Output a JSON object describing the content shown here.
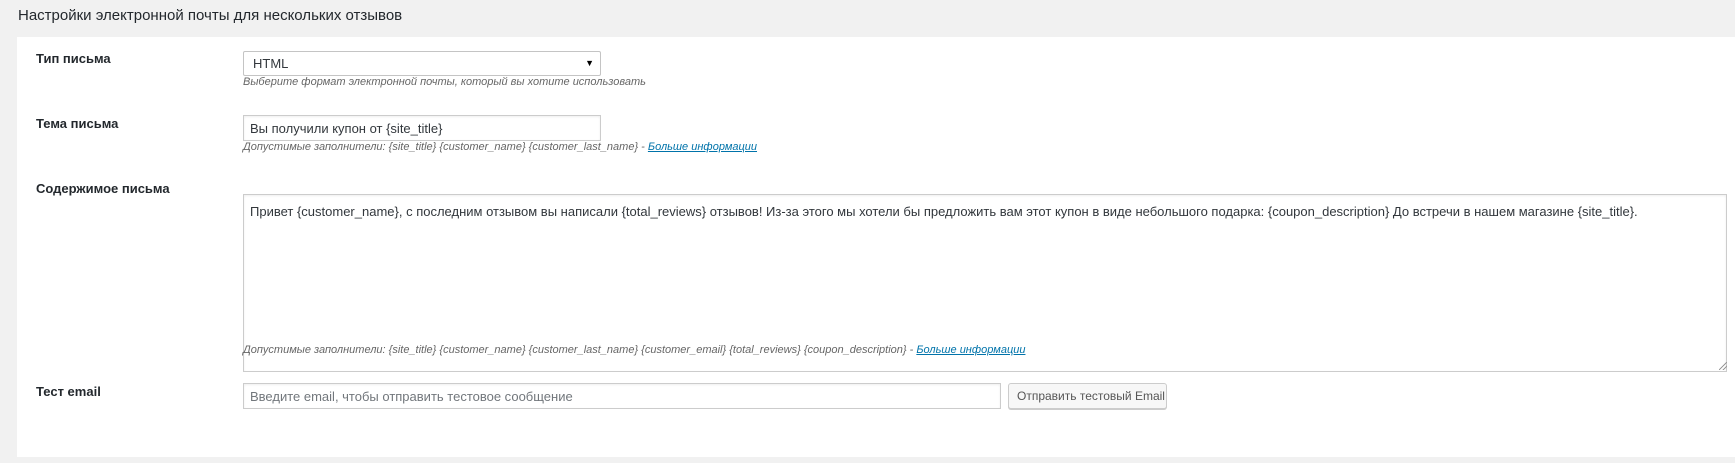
{
  "section": {
    "title": "Настройки электронной почты для нескольких отзывов"
  },
  "email_type": {
    "label": "Тип письма",
    "value": "HTML",
    "description": "Выберите формат электронной почты, который вы хотите использовать"
  },
  "email_subject": {
    "label": "Тема письма",
    "value": "Вы получили купон от {site_title}",
    "description": "Допустимые заполнители: {site_title} {customer_name} {customer_last_name} - ",
    "link": "Больше информации"
  },
  "email_content": {
    "label": "Содержимое письма",
    "value": "Привет {customer_name}, с последним отзывом вы написали {total_reviews} отзывов! Из-за этого мы хотели бы предложить вам этот купон в виде небольшого подарка: {coupon_description} До встречи в нашем магазине {site_title}.",
    "description": "Допустимые заполнители: {site_title} {customer_name} {customer_last_name} {customer_email} {total_reviews} {coupon_description} - ",
    "link": "Больше информации"
  },
  "test_email": {
    "label": "Тест email",
    "placeholder": "Введите email, чтобы отправить тестовое сообщение",
    "button_label": "Отправить тестовый Email"
  }
}
